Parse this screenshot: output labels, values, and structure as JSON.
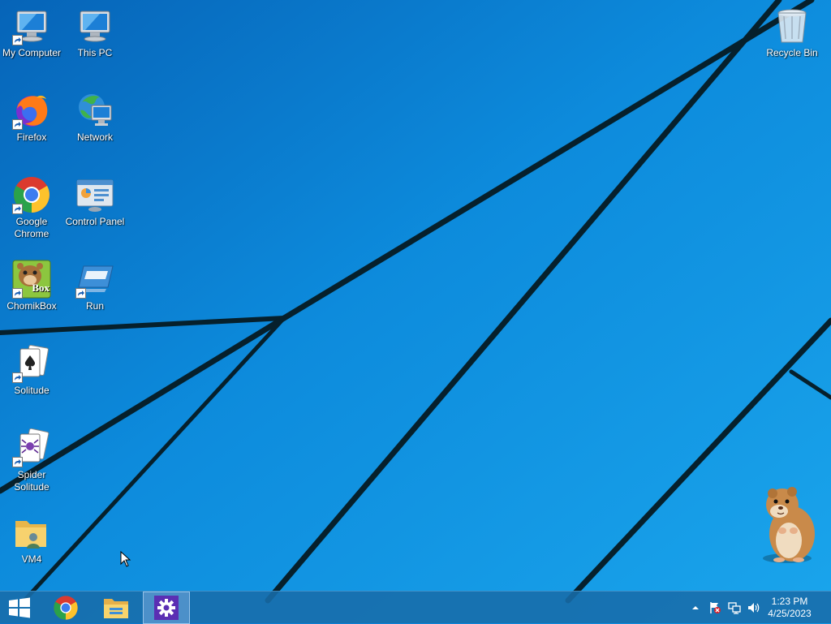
{
  "desktop": {
    "icons": [
      {
        "label": "My Computer",
        "icon": "my-computer-icon"
      },
      {
        "label": "This PC",
        "icon": "this-pc-icon"
      },
      {
        "label": "Firefox",
        "icon": "firefox-icon"
      },
      {
        "label": "Network",
        "icon": "network-icon"
      },
      {
        "label": "Google Chrome",
        "icon": "chrome-icon"
      },
      {
        "label": "Control Panel",
        "icon": "control-panel-icon"
      },
      {
        "label": "ChomikBox",
        "icon": "chomikbox-icon"
      },
      {
        "label": "Run",
        "icon": "run-icon"
      },
      {
        "label": "Solitude",
        "icon": "solitaire-cards-icon"
      },
      {
        "label": "Spider Solitude",
        "icon": "spider-solitaire-icon"
      },
      {
        "label": "VM4",
        "icon": "folder-user-icon"
      },
      {
        "label": "Recycle Bin",
        "icon": "recycle-bin-icon"
      }
    ],
    "chomikbox_badge": "Box"
  },
  "taskbar": {
    "pinned": [
      {
        "name": "start-button",
        "icon": "windows-logo-icon"
      },
      {
        "name": "chrome-taskbar-button",
        "icon": "chrome-icon"
      },
      {
        "name": "file-explorer-taskbar-button",
        "icon": "folder-icon"
      },
      {
        "name": "settings-taskbar-button",
        "icon": "gear-icon",
        "active": true
      }
    ],
    "tray": {
      "icons": [
        "chevron-up-icon",
        "action-center-flag-icon",
        "network-icon",
        "volume-icon"
      ]
    },
    "clock": {
      "time": "1:23 PM",
      "date": "4/25/2023"
    }
  },
  "colors": {
    "wallpaper_blue": "#0c87dc",
    "wallpaper_lines": "#06202c",
    "taskbar": "#186caa",
    "settings_accent": "#5b2fb3"
  }
}
